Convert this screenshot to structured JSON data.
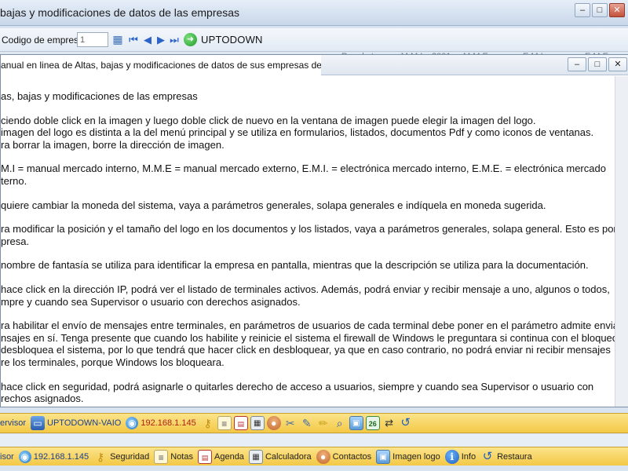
{
  "main_window": {
    "title": "bajas y modificaciones de datos de las empresas",
    "controls": [
      "–",
      "□",
      "✕"
    ]
  },
  "toolbar": {
    "company_code_label": "Codigo de empresa",
    "company_code_value": "1",
    "company_name": "UPTODOWN",
    "icons": [
      "grid-icon",
      "first-record-icon",
      "prev-record-icon",
      "next-record-icon",
      "last-record-icon",
      "go-icon"
    ]
  },
  "hidden_row": {
    "ghost_1": "Por. de temor - M.M.I.",
    "ghost_2": "2001",
    "ghost_3": "M.M.E.",
    "ghost_4": "E.M.I.",
    "ghost_5": "E.M.E."
  },
  "help_window": {
    "title": "anual en linea de Altas, bajas y modificaciones de datos de sus empresas de",
    "controls": [
      "–",
      "□",
      "✕"
    ],
    "heading": "as, bajas y modificaciones de las empresas",
    "paragraphs": [
      [
        "ciendo doble click en la imagen y luego doble click de nuevo en la ventana de imagen puede elegir la imagen del logo.",
        "imagen del logo es distinta a la del menú principal y se utiliza en formularios,  listados, documentos Pdf y como iconos de ventanas.",
        "ra borrar la imagen, borre la dirección de imagen."
      ],
      [
        "M.I = manual mercado interno, M.M.E = manual mercado externo, E.M.I. = electrónica mercado interno, E.M.E. = electrónica  mercado",
        "terno."
      ],
      [
        "quiere cambiar la moneda del sistema, vaya a parámetros generales, solapa generales e indíquela en moneda sugerida."
      ],
      [
        "ra modificar la posición y el tamaño del logo en los documentos y los listados, vaya a parámetros generales, solapa general. Esto es por",
        "presa."
      ],
      [
        "nombre de fantasía se utiliza para identificar la empresa en pantalla, mientras que la descripción se utiliza para la documentación."
      ],
      [
        "hace click en la dirección IP, podrá ver el listado de terminales activos. Además, podrá enviar y recibir mensaje a uno, algunos o todos,",
        "mpre y cuando sea Supervisor o usuario con derechos asignados."
      ],
      [
        "ra habilitar el envío de mensajes entre terminales, en parámetros de usuarios de cada terminal  debe poner en el parámetro admite enviar",
        "nsajes en sí. Tenga presente que cuando los habilite y reinicie el sistema el firewall de Windows le preguntara si continua con el bloqueo",
        "desbloquea el sistema,  por lo que tendrá que hacer click en desbloquear, ya que en caso contrario, no podrá enviar ni recibir mensajes",
        "re los terminales, porque Windows los bloqueara."
      ],
      [
        "hace click en seguridad, podrá asignarle o quitarles derecho de acceso a usuarios, siempre y cuando sea Supervisor o usuario con",
        "rechos asignados."
      ]
    ]
  },
  "status_bar_1": {
    "role": "ervisor",
    "computer": "UPTODOWN-VAIO",
    "ip": "192.168.1.145"
  },
  "status_bar_2": {
    "role": "isor",
    "ip": "192.168.1.145",
    "seguridad": "Seguridad",
    "notas": "Notas",
    "agenda": "Agenda",
    "calculadora": "Calculadora",
    "contactos": "Contactos",
    "imagen_logo": "Imagen logo",
    "info": "Info",
    "restaura": "Restaura"
  }
}
